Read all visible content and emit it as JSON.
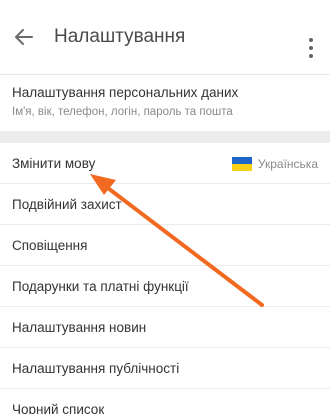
{
  "header": {
    "title": "Налаштування",
    "back_icon": "arrow-left-icon",
    "more_icon": "more-vertical-icon"
  },
  "personal": {
    "title": "Налаштування персональних даних",
    "subtitle": "Ім'я, вік, телефон, логін, пароль та пошта"
  },
  "menu": {
    "items": [
      {
        "label": "Змінити мову",
        "value": "Українська"
      },
      {
        "label": "Подвійний захист"
      },
      {
        "label": "Сповіщення"
      },
      {
        "label": "Подарунки та платні функції"
      },
      {
        "label": "Налаштування новин"
      },
      {
        "label": "Налаштування публічності"
      },
      {
        "label": "Чорний список"
      }
    ]
  },
  "colors": {
    "annotation_arrow": "#f26a21",
    "flag_blue": "#1f66c8",
    "flag_yellow": "#f7d117"
  }
}
